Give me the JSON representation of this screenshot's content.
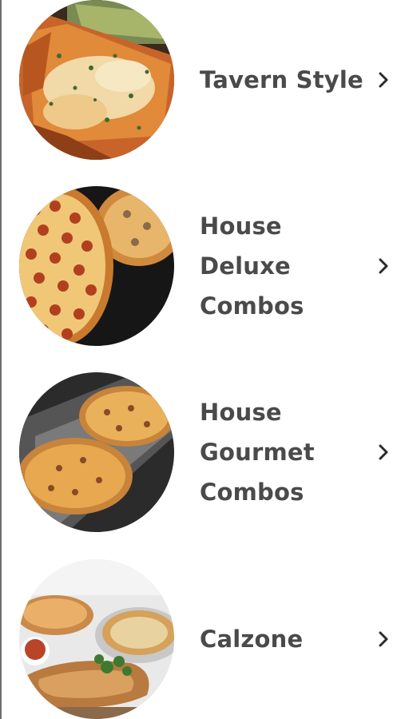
{
  "menu": {
    "items": [
      {
        "label": "Tavern Style",
        "image": "tavern-pizza-image"
      },
      {
        "label": "House Deluxe Combos",
        "image": "pepperoni-pizza-image"
      },
      {
        "label": "House Gourmet Combos",
        "image": "gourmet-pizzas-image"
      },
      {
        "label": "Calzone",
        "image": "calzone-image"
      }
    ],
    "chevron_icon": "chevron-right-icon"
  },
  "colors": {
    "text": "#4a4a4a",
    "chevron": "#2b2b2b",
    "background": "#ffffff"
  }
}
